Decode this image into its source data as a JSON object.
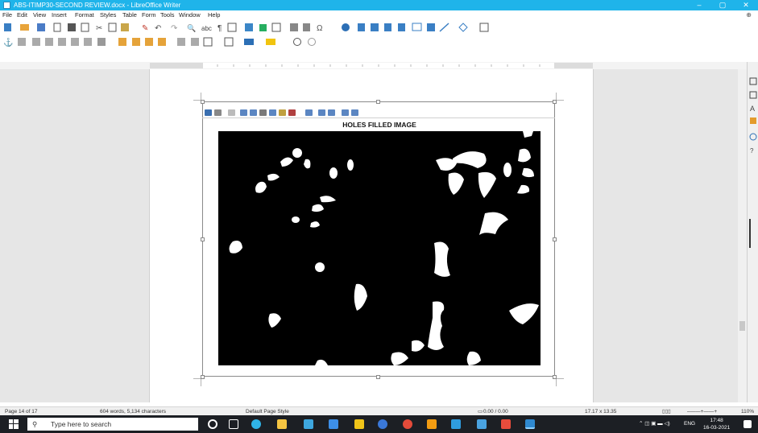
{
  "window": {
    "title": "ABS-ITIMP30-SECOND REVIEW.docx - LibreOffice Writer",
    "minimize": "–",
    "maximize": "▢",
    "close": "✕"
  },
  "menu": [
    "File",
    "Edit",
    "View",
    "Insert",
    "Format",
    "Styles",
    "Table",
    "Form",
    "Tools",
    "Window",
    "Help"
  ],
  "figure": {
    "title": "HOLES FILLED IMAGE"
  },
  "status": {
    "page": "Page 14 of 17",
    "words": "604 words, 5,134 characters",
    "style": "Default Page Style",
    "position": "0.00 / 0.00",
    "size": "17.17 x 13.35",
    "zoom": "110%"
  },
  "taskbar": {
    "search_placeholder": "Type here to search",
    "lang": "ENG",
    "time": "17:48",
    "date": "16-03-2021"
  },
  "colors": {
    "titlebar": "#1fb4ea",
    "taskbar": "#1c1f24",
    "image_bg": "#000000",
    "blobs": "#ffffff"
  },
  "icons": [
    "windows-icon",
    "search-icon",
    "cortana-icon",
    "taskview-icon",
    "edge-icon",
    "file-explorer-icon",
    "store-icon",
    "dropbox-icon",
    "mail-icon",
    "chrome-icon",
    "photos-icon",
    "libreoffice-writer-icon"
  ]
}
